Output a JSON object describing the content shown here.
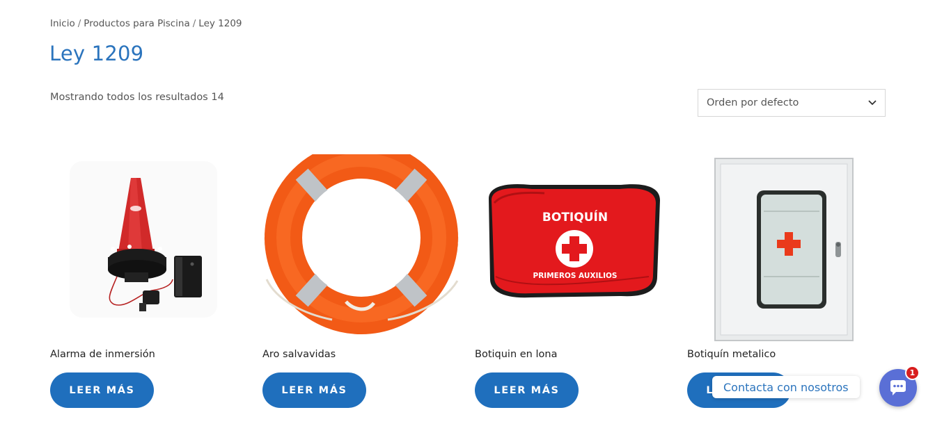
{
  "breadcrumb": {
    "home": "Inicio",
    "category": "Productos para Piscina",
    "current": "Ley 1209",
    "separator": "/"
  },
  "page_title": "Ley 1209",
  "result_count": "Mostrando todos los resultados 14",
  "orderby": {
    "selected": "Orden por defecto",
    "icon": "chevron-down-icon"
  },
  "products": [
    {
      "name": "Alarma de inmersión",
      "button": "LEER MÁS",
      "image": "pool-alarm-image"
    },
    {
      "name": "Aro salvavidas",
      "button": "LEER MÁS",
      "image": "lifebuoy-image"
    },
    {
      "name": "Botiquin en lona",
      "button": "LEER MÁS",
      "image": "first-aid-bag-image",
      "image_text_top": "BOTIQUÍN",
      "image_text_bottom": "PRIMEROS AUXILIOS"
    },
    {
      "name": "Botiquín metalico",
      "button": "LEER MÁS",
      "image": "metal-cabinet-image"
    }
  ],
  "chat": {
    "bubble_label": "Contacta con nosotros",
    "badge_count": "1",
    "icon": "chat-icon"
  },
  "colors": {
    "accent": "#1f6fbd",
    "title": "#2b74bd",
    "chat": "#5a6fd6",
    "badge": "#d81e1e"
  }
}
